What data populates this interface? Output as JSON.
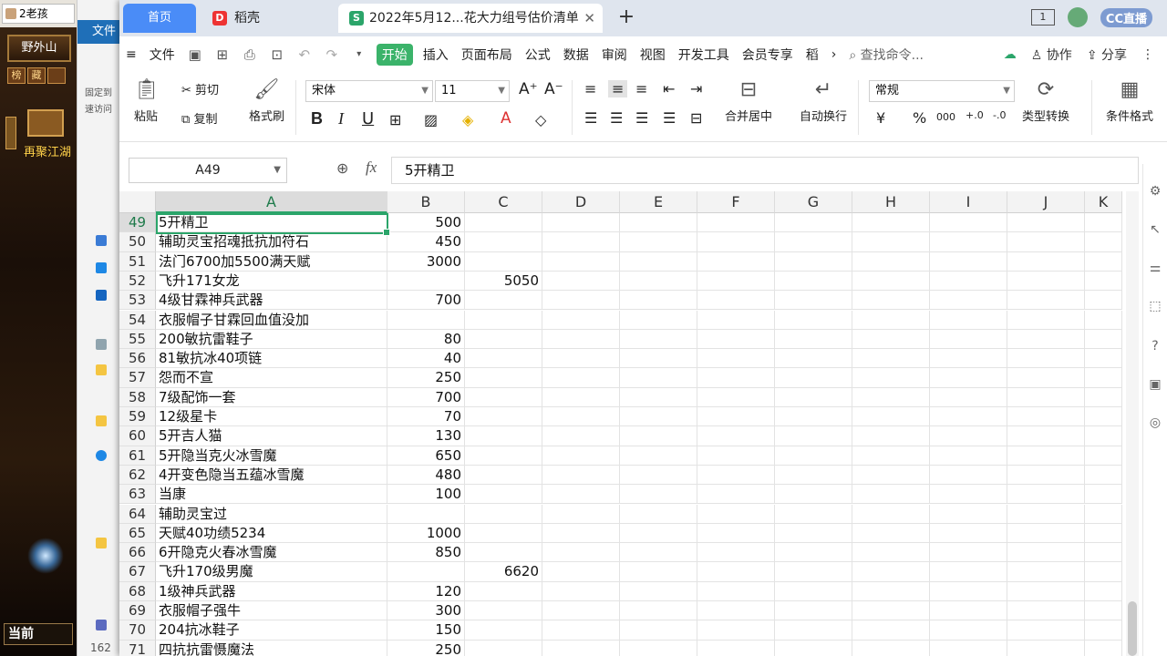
{
  "game": {
    "tab_title": "2老孩",
    "zone_name": "野外山",
    "buttons": [
      "榜",
      "藏",
      ""
    ],
    "promo_text": "再聚江湖",
    "current_label": "当前"
  },
  "explorer": {
    "file_tab": "文件",
    "pin_text_1": "固定到",
    "pin_text_2": "速访问",
    "item_count": "162"
  },
  "tabs": {
    "home": "首页",
    "daoke": "稻壳",
    "daoke_icon_letter": "D",
    "doc_title": "2022年5月12...花大力组号估价清单",
    "doc_icon_letter": "S",
    "close_symbol": "✕",
    "plus_symbol": "+"
  },
  "window": {
    "counter": "1",
    "cc_label": "CC直播"
  },
  "menu": {
    "file": "文件",
    "start": "开始",
    "items": [
      "插入",
      "页面布局",
      "公式",
      "数据",
      "审阅",
      "视图",
      "开发工具",
      "会员专享",
      "稻"
    ],
    "more": "›",
    "search_placeholder": "查找命令...",
    "cloud": "",
    "collab": "协作",
    "share": "分享",
    "overflow": "⋮"
  },
  "ribbon": {
    "paste": "粘贴",
    "cut": "剪切",
    "copy": "复制",
    "format_painter": "格式刷",
    "font_name": "宋体",
    "font_size": "11",
    "bold": "B",
    "italic": "I",
    "underline": "U",
    "merge_center": "合并居中",
    "auto_wrap": "自动换行",
    "number_format": "常规",
    "currency": "¥",
    "percent": "%",
    "thousands": "000",
    "type_convert": "类型转换",
    "cond_format": "条件格式"
  },
  "formula_bar": {
    "cell_ref": "A49",
    "fx": "fx",
    "content": "5开精卫"
  },
  "columns": [
    "A",
    "B",
    "C",
    "D",
    "E",
    "F",
    "G",
    "H",
    "I",
    "J",
    "K"
  ],
  "rows": [
    {
      "n": "49",
      "a": "5开精卫",
      "b": "500",
      "c": ""
    },
    {
      "n": "50",
      "a": "辅助灵宝招魂抵抗加符石",
      "b": "450",
      "c": ""
    },
    {
      "n": "51",
      "a": "法门6700加5500满天赋",
      "b": "3000",
      "c": ""
    },
    {
      "n": "52",
      "a": "飞升171女龙",
      "b": "",
      "c": "5050"
    },
    {
      "n": "53",
      "a": "4级甘霖神兵武器",
      "b": "700",
      "c": ""
    },
    {
      "n": "54",
      "a": "衣服帽子甘霖回血值没加",
      "b": "",
      "c": ""
    },
    {
      "n": "55",
      "a": "200敏抗雷鞋子",
      "b": "80",
      "c": ""
    },
    {
      "n": "56",
      "a": "81敏抗冰40项链",
      "b": "40",
      "c": ""
    },
    {
      "n": "57",
      "a": "怨而不宣",
      "b": "250",
      "c": ""
    },
    {
      "n": "58",
      "a": "7级配饰一套",
      "b": "700",
      "c": ""
    },
    {
      "n": "59",
      "a": "12级星卡",
      "b": "70",
      "c": ""
    },
    {
      "n": "60",
      "a": "5开吉人猫",
      "b": "130",
      "c": ""
    },
    {
      "n": "61",
      "a": "5开隐当克火冰雪魔",
      "b": "650",
      "c": ""
    },
    {
      "n": "62",
      "a": "4开变色隐当五蕴冰雪魔",
      "b": "480",
      "c": ""
    },
    {
      "n": "63",
      "a": "当康",
      "b": "100",
      "c": ""
    },
    {
      "n": "64",
      "a": "辅助灵宝过",
      "b": "",
      "c": ""
    },
    {
      "n": "65",
      "a": "天赋40功绩5234",
      "b": "1000",
      "c": ""
    },
    {
      "n": "66",
      "a": "6开隐克火春冰雪魔",
      "b": "850",
      "c": ""
    },
    {
      "n": "67",
      "a": "飞升170级男魔",
      "b": "",
      "c": "6620"
    },
    {
      "n": "68",
      "a": "1级神兵武器",
      "b": "120",
      "c": ""
    },
    {
      "n": "69",
      "a": "衣服帽子强牛",
      "b": "300",
      "c": ""
    },
    {
      "n": "70",
      "a": "204抗冰鞋子",
      "b": "150",
      "c": ""
    },
    {
      "n": "71",
      "a": "四抗抗雷慑魔法",
      "b": "250",
      "c": ""
    }
  ],
  "colors": {
    "accent_green": "#2ba56a",
    "home_tab_blue": "#4a8cf7",
    "start_green": "#3bb36a"
  }
}
